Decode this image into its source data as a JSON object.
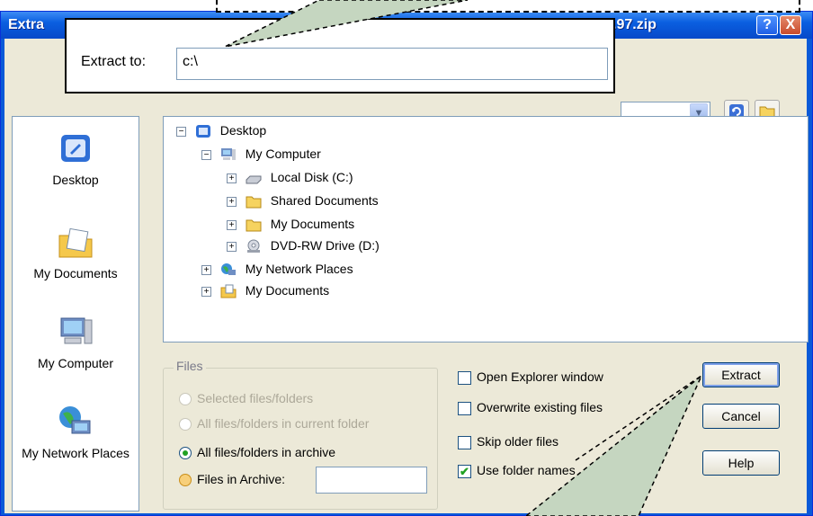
{
  "window": {
    "title_prefix": "Extra",
    "title_suffix": ".97.zip",
    "help_label": "?",
    "close_label": "X"
  },
  "callout": {
    "extract_label": "Extract to:",
    "extract_path": "c:\\"
  },
  "places": [
    {
      "label": "Desktop",
      "icon": "desktop-icon"
    },
    {
      "label": "My Documents",
      "icon": "my-documents-icon"
    },
    {
      "label": "My Computer",
      "icon": "my-computer-icon"
    },
    {
      "label": "My Network Places",
      "icon": "network-places-icon"
    }
  ],
  "tree": {
    "desktop": "Desktop",
    "my_computer": "My Computer",
    "local_disk": "Local Disk (C:)",
    "shared_documents": "Shared Documents",
    "my_documents_sub": "My Documents",
    "dvd_drive": "DVD-RW Drive (D:)",
    "network_places": "My Network Places",
    "my_documents": "My Documents"
  },
  "files_group": {
    "legend": "Files",
    "options": {
      "selected": "Selected files/folders",
      "current_folder": "All files/folders in current folder",
      "archive": "All files/folders in archive",
      "in_archive": "Files in Archive:"
    },
    "files_in_archive_value": ""
  },
  "checkboxes": {
    "open_explorer": {
      "label": "Open Explorer window",
      "checked": false
    },
    "overwrite": {
      "label": "Overwrite existing files",
      "checked": false
    },
    "skip_older": {
      "label": "Skip older files",
      "checked": false
    },
    "use_folder_names": {
      "label": "Use folder names",
      "checked": true
    }
  },
  "buttons": {
    "extract": "Extract",
    "cancel": "Cancel",
    "help": "Help"
  },
  "colors": {
    "titlebar": "#0a5fe0",
    "dialog_bg": "#ece9d8",
    "callout_pointer": "#c5d6c0"
  }
}
